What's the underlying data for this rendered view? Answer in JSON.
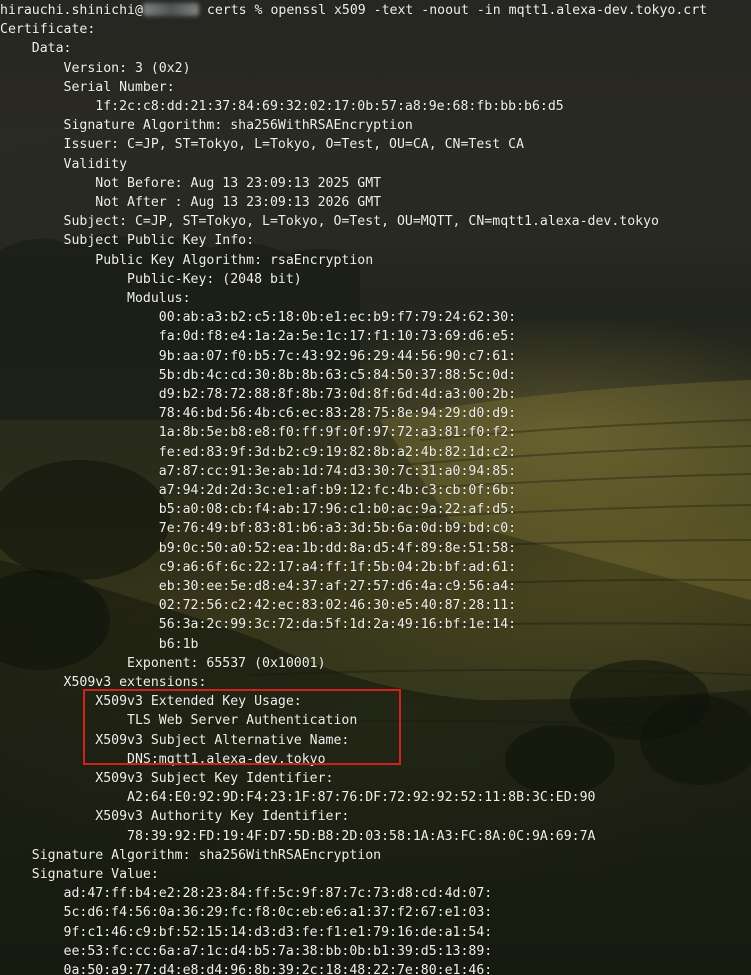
{
  "terminal": {
    "prompt": {
      "user": "hirauchi.shinichi@",
      "directory": "certs",
      "symbol": "%",
      "command": "openssl x509 -text -noout -in mqtt1.alexa-dev.tokyo.crt"
    },
    "lines": [
      "Certificate:",
      "    Data:",
      "        Version: 3 (0x2)",
      "        Serial Number:",
      "            1f:2c:c8:dd:21:37:84:69:32:02:17:0b:57:a8:9e:68:fb:bb:b6:d5",
      "        Signature Algorithm: sha256WithRSAEncryption",
      "        Issuer: C=JP, ST=Tokyo, L=Tokyo, O=Test, OU=CA, CN=Test CA",
      "        Validity",
      "            Not Before: Aug 13 23:09:13 2025 GMT",
      "            Not After : Aug 13 23:09:13 2026 GMT",
      "        Subject: C=JP, ST=Tokyo, L=Tokyo, O=Test, OU=MQTT, CN=mqtt1.alexa-dev.tokyo",
      "        Subject Public Key Info:",
      "            Public Key Algorithm: rsaEncryption",
      "                Public-Key: (2048 bit)",
      "                Modulus:",
      "                    00:ab:a3:b2:c5:18:0b:e1:ec:b9:f7:79:24:62:30:",
      "                    fa:0d:f8:e4:1a:2a:5e:1c:17:f1:10:73:69:d6:e5:",
      "                    9b:aa:07:f0:b5:7c:43:92:96:29:44:56:90:c7:61:",
      "                    5b:db:4c:cd:30:8b:8b:63:c5:84:50:37:88:5c:0d:",
      "                    d9:b2:78:72:88:8f:8b:73:0d:8f:6d:4d:a3:00:2b:",
      "                    78:46:bd:56:4b:c6:ec:83:28:75:8e:94:29:d0:d9:",
      "                    1a:8b:5e:b8:e8:f0:ff:9f:0f:97:72:a3:81:f0:f2:",
      "                    fe:ed:83:9f:3d:b2:c9:19:82:8b:a2:4b:82:1d:c2:",
      "                    a7:87:cc:91:3e:ab:1d:74:d3:30:7c:31:a0:94:85:",
      "                    a7:94:2d:2d:3c:e1:af:b9:12:fc:4b:c3:cb:0f:6b:",
      "                    b5:a0:08:cb:f4:ab:17:96:c1:b0:ac:9a:22:af:d5:",
      "                    7e:76:49:bf:83:81:b6:a3:3d:5b:6a:0d:b9:bd:c0:",
      "                    b9:0c:50:a0:52:ea:1b:dd:8a:d5:4f:89:8e:51:58:",
      "                    c9:a6:6f:6c:22:17:a4:ff:1f:5b:04:2b:bf:ad:61:",
      "                    eb:30:ee:5e:d8:e4:37:af:27:57:d6:4a:c9:56:a4:",
      "                    02:72:56:c2:42:ec:83:02:46:30:e5:40:87:28:11:",
      "                    56:3a:2c:99:3c:72:da:5f:1d:2a:49:16:bf:1e:14:",
      "                    b6:1b",
      "                Exponent: 65537 (0x10001)",
      "        X509v3 extensions:",
      "            X509v3 Extended Key Usage:",
      "                TLS Web Server Authentication",
      "            X509v3 Subject Alternative Name:",
      "                DNS:mqtt1.alexa-dev.tokyo",
      "            X509v3 Subject Key Identifier:",
      "                A2:64:E0:92:9D:F4:23:1F:87:76:DF:72:92:92:52:11:8B:3C:ED:90",
      "            X509v3 Authority Key Identifier:",
      "                78:39:92:FD:19:4F:D7:5D:B8:2D:03:58:1A:A3:FC:8A:0C:9A:69:7A",
      "    Signature Algorithm: sha256WithRSAEncryption",
      "    Signature Value:",
      "        ad:47:ff:b4:e2:28:23:84:ff:5c:9f:87:7c:73:d8:cd:4d:07:",
      "        5c:d6:f4:56:0a:36:29:fc:f8:0c:eb:e6:a1:37:f2:67:e1:03:",
      "        9f:c1:46:c9:bf:52:15:14:d3:d3:fe:f1:e1:79:16:de:a1:54:",
      "        ee:53:fc:cc:6a:a7:1c:d4:b5:7a:38:bb:0b:b1:39:d5:13:89:",
      "        0a:50:a9:77:d4:e8:d4:96:8b:39:2c:18:48:22:7e:80:e1:46:"
    ]
  },
  "colors": {
    "text": "#f0f0ec",
    "highlight_border": "#d21f1f"
  }
}
